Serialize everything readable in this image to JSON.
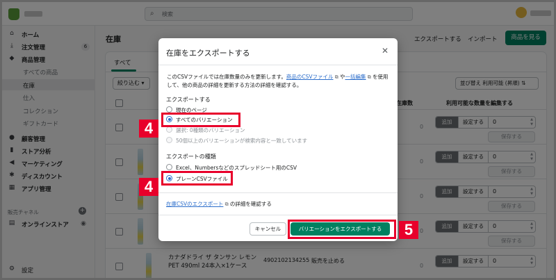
{
  "topbar": {
    "search_placeholder": "検索"
  },
  "sidebar": {
    "items": [
      {
        "label": "ホーム",
        "icon": "home-icon"
      },
      {
        "label": "注文管理",
        "icon": "download-icon",
        "badge": "6"
      },
      {
        "label": "商品管理",
        "icon": "tag-icon"
      },
      {
        "label": "すべての商品",
        "sub": true
      },
      {
        "label": "在庫",
        "sub": true,
        "active": true
      },
      {
        "label": "仕入",
        "sub": true
      },
      {
        "label": "コレクション",
        "sub": true
      },
      {
        "label": "ギフトカード",
        "sub": true
      },
      {
        "label": "顧客管理",
        "icon": "person-icon"
      },
      {
        "label": "ストア分析",
        "icon": "bar-chart-icon"
      },
      {
        "label": "マーケティング",
        "icon": "megaphone-icon"
      },
      {
        "label": "ディスカウント",
        "icon": "discount-icon"
      },
      {
        "label": "アプリ管理",
        "icon": "apps-icon"
      }
    ],
    "channels_label": "販売チャネル",
    "online_store": "オンラインストア",
    "settings": "設定"
  },
  "main": {
    "title": "在庫",
    "export_link": "エクスポートする",
    "import_link": "インポート",
    "view_products": "商品を見る",
    "tab_all": "すべて",
    "filter": "絞り込む",
    "sort": "並び替え 利用可能 (昇順)",
    "col_stock": "在庫数",
    "col_edit": "利用可能な数量を編集する",
    "row": {
      "zero": "0",
      "add": "追加",
      "set": "設定する",
      "qty": "0",
      "save": "保存する"
    },
    "last_product": {
      "name": "カナダドライ ザ タンサン レモン PET 490ml 24本入×1ケース",
      "sku": "4902102134255",
      "stop": "販売を止める"
    }
  },
  "modal": {
    "title": "在庫をエクスポートする",
    "desc_pre": "このCSVファイルでは在庫数量のみを更新します。",
    "desc_link1": "商品のCSVファイル",
    "desc_mid": "や",
    "desc_link2": "一括編集",
    "desc_post": "を使用して、他の商品の詳細を更新する方法の詳細を確認する。",
    "export_label": "エクスポートする",
    "export_options": [
      {
        "label": "現在のページ",
        "checked": false,
        "disabled": false
      },
      {
        "label": "すべてのバリエーション",
        "checked": true,
        "disabled": false
      },
      {
        "label": "選択: 0種類のバリエーション",
        "checked": false,
        "disabled": true
      },
      {
        "label": "50個以上のバリエーションが検索内容と一致しています",
        "checked": false,
        "disabled": true
      }
    ],
    "type_label": "エクスポートの種類",
    "type_options": [
      {
        "label": "Excel、Numbersなどのスプレッドシート用のCSV",
        "checked": false
      },
      {
        "label": "プレーンCSVファイル",
        "checked": true
      }
    ],
    "help_link": "在庫CSVのエクスポート",
    "help_post": "の詳細を確認する",
    "cancel": "キャンセル",
    "export_button": "バリエーションをエクスポートする"
  },
  "callouts": {
    "step4": "4",
    "step5": "5"
  },
  "colors": {
    "primary": "#008060",
    "callout": "#e8002b",
    "link": "#2c6ecb"
  }
}
